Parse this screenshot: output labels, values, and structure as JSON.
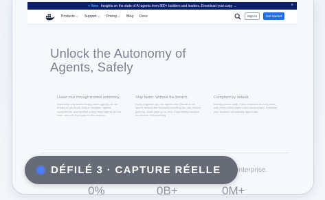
{
  "announcement": {
    "badge": "New",
    "text": "Insights on the state of AI agents from 800+ builders and leaders. Download your copy →",
    "close": "×"
  },
  "nav": {
    "items": [
      "Products ⌵",
      "Support ⌵",
      "Pricing ⌵",
      "Blog",
      "Docs"
    ],
    "signin_label": "Sign In",
    "get_started_label": "Get Started"
  },
  "hero": {
    "title": "Unlock the Autonomy of Agents, Safely"
  },
  "features": [
    {
      "title": "Lower cost through trusted autonomy.",
      "body": "Autonomy only saves money when agents can be trusted to act alone. Built-in isolation, signed components, and runtime policy mean agents do the work, and you don't pay for the cleanup."
    },
    {
      "title": "Ship faster. Without the breach.",
      "body": "Every engineer can run agents and Claude at full speed, without the business inheriting the risk. Output goes up. Audit gaps go to zero. Engineering focuses on product, not plumbing."
    },
    {
      "title": "Compliant by default.",
      "body": "Identity-bound audit. Policy enforced at every step, with every action signed and documented. Evidence your auditors will actually appreciate."
    }
  ],
  "bottom": {
    "partial_heading": "enterprise."
  },
  "stats": [
    "0%",
    "0B+",
    "0M+"
  ],
  "overlay": {
    "label": "DÉFILÉ 3 · CAPTURE RÉELLE"
  },
  "colors": {
    "announcement_bg": "#0b1f6b",
    "primary_button": "#1f6feb",
    "overlay_dot": "#4c7dff"
  }
}
